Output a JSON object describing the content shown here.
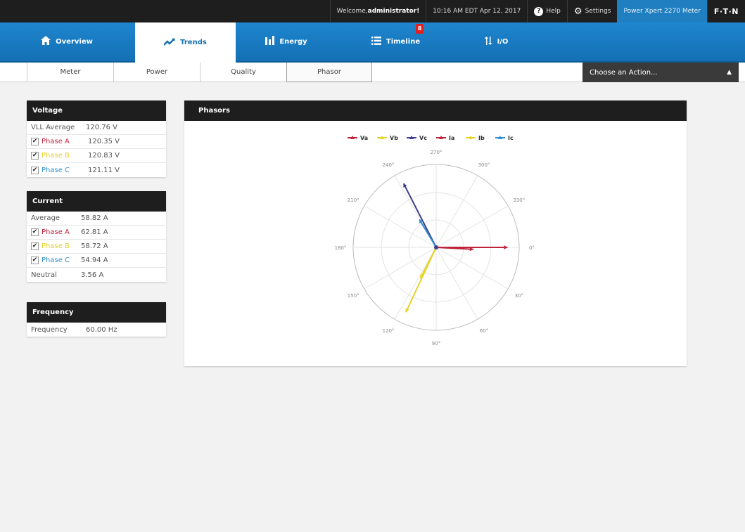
{
  "topbar": {
    "welcome_prefix": "Welcome, ",
    "user": "administrator!",
    "datetime": "10:16 AM EDT Apr 12, 2017",
    "help": "Help",
    "settings": "Settings",
    "device": "Power Xpert 2270 Meter",
    "brand": "F·T·N",
    "help_icon": "question-circle-icon",
    "settings_icon": "gear-icon"
  },
  "nav": {
    "items": [
      {
        "label": "Overview",
        "icon": "home-icon"
      },
      {
        "label": "Trends",
        "icon": "trend-line-icon"
      },
      {
        "label": "Energy",
        "icon": "bar-chart-icon"
      },
      {
        "label": "Timeline",
        "icon": "list-icon",
        "badge": "8"
      },
      {
        "label": "I/O",
        "icon": "up-down-arrows-icon"
      }
    ],
    "active": "Trends"
  },
  "subnav": {
    "tabs": [
      "Meter",
      "Power",
      "Quality",
      "Phasor"
    ],
    "active": "Phasor",
    "action_label": "Choose an Action..."
  },
  "voltage": {
    "title": "Voltage",
    "average_label": "VLL Average",
    "average_value": "120.76 V",
    "phases": [
      {
        "label": "Phase A",
        "value": "120.35 V",
        "checked": true
      },
      {
        "label": "Phase B",
        "value": "120.83 V",
        "checked": true
      },
      {
        "label": "Phase C",
        "value": "121.11 V",
        "checked": true
      }
    ]
  },
  "current": {
    "title": "Current",
    "average_label": "Average",
    "average_value": "58.82 A",
    "phases": [
      {
        "label": "Phase A",
        "value": "62.81 A",
        "checked": true
      },
      {
        "label": "Phase B",
        "value": "58.72 A",
        "checked": true
      },
      {
        "label": "Phase C",
        "value": "54.94 A",
        "checked": true
      }
    ],
    "neutral_label": "Neutral",
    "neutral_value": "3.56 A"
  },
  "frequency": {
    "title": "Frequency",
    "label": "Frequency",
    "value": "60.00 Hz"
  },
  "phasors_panel": {
    "title": "Phasors"
  },
  "colors": {
    "phase_a": "#c0233c",
    "phase_b": "#e8d22c",
    "phase_c": "#2f8fd0",
    "vc": "#3d3f8a"
  },
  "chart_data": {
    "type": "polar",
    "title": "Phasors",
    "angle_labels": [
      "0°",
      "30°",
      "60°",
      "90°",
      "120°",
      "150°",
      "180°",
      "210°",
      "240°",
      "270°",
      "300°",
      "330°"
    ],
    "angle_direction": "clockwise",
    "series": [
      {
        "name": "Va",
        "color": "#c0233c",
        "magnitude": 120.35,
        "angle": 0
      },
      {
        "name": "Vb",
        "color": "#e8d22c",
        "magnitude": 120.83,
        "angle": 115
      },
      {
        "name": "Vc",
        "color": "#3d3f8a",
        "magnitude": 121.11,
        "angle": 243
      },
      {
        "name": "Ia",
        "color": "#c0233c",
        "magnitude": 62.81,
        "angle": 3
      },
      {
        "name": "Ib",
        "color": "#e8d22c",
        "magnitude": 58.72,
        "angle": 117
      },
      {
        "name": "Ic",
        "color": "#2f8fd0",
        "magnitude": 54.94,
        "angle": 239
      }
    ],
    "legend": "top"
  }
}
